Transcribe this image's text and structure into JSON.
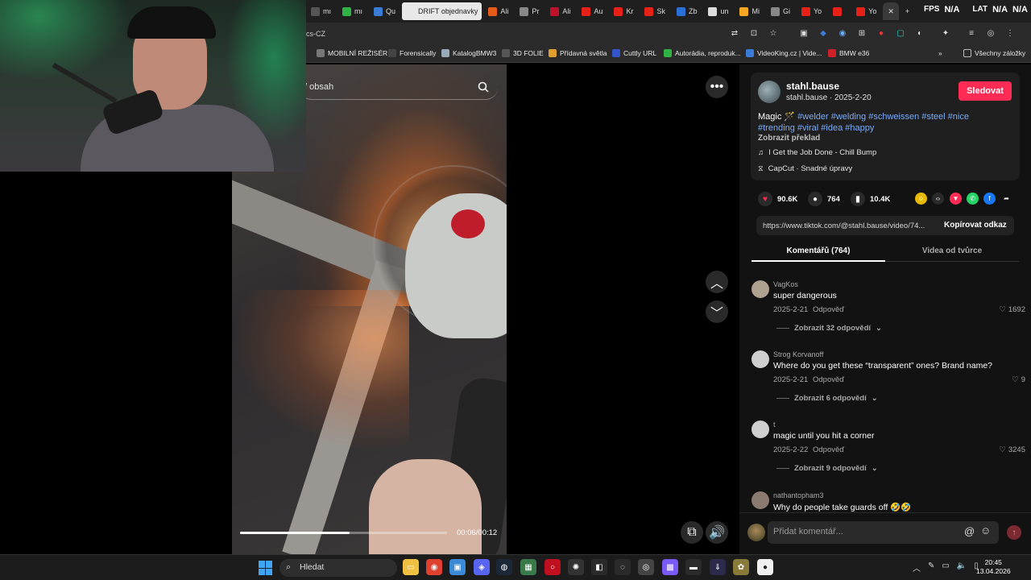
{
  "browser": {
    "tabs": [
      {
        "label": "mı",
        "color": "#555555"
      },
      {
        "label": "mı",
        "color": "#2fb344"
      },
      {
        "label": "Qu",
        "color": "#3a7bd5"
      },
      {
        "label": "DRIFT objednavky",
        "color": "#e8e8e8",
        "active": true
      },
      {
        "label": "Ali",
        "color": "#e55b1a"
      },
      {
        "label": "Pr",
        "color": "#888888"
      },
      {
        "label": "Ali",
        "color": "#c0112b"
      },
      {
        "label": "Au",
        "color": "#e62117"
      },
      {
        "label": "Kr",
        "color": "#e62117"
      },
      {
        "label": "Sk",
        "color": "#e62117"
      },
      {
        "label": "Zb",
        "color": "#2a6fd6"
      },
      {
        "label": "un",
        "color": "#dddddd"
      },
      {
        "label": "Mi",
        "color": "#f5a623"
      },
      {
        "label": "Gi",
        "color": "#888888"
      },
      {
        "label": "Yo",
        "color": "#e62117"
      },
      {
        "label": "",
        "color": "#e62117"
      },
      {
        "label": "Yo",
        "color": "#e62117"
      }
    ],
    "fps_label": "FPS",
    "fps_value": "N/A",
    "lat_label": "LAT",
    "lat_value": "N/A",
    "extra_value": "N/A",
    "url": "cs-CZ",
    "bookmarks": [
      {
        "label": "MOBILNÍ REŽISÉR",
        "color": "#777777"
      },
      {
        "label": "Forensically",
        "color": "#444444"
      },
      {
        "label": "KatalogBMW3",
        "color": "#9ab"
      },
      {
        "label": "3D FOLIE",
        "color": "#555555"
      },
      {
        "label": "Přídavná světla",
        "color": "#e0a030"
      },
      {
        "label": "Cuttly URL",
        "color": "#3355cc"
      },
      {
        "label": "Autorádia, reproduk...",
        "color": "#2fb344"
      },
      {
        "label": "VideoKing.cz | Vide...",
        "color": "#3a7bd5"
      },
      {
        "label": "BMW e36",
        "color": "#d0202a"
      }
    ],
    "all_bookmarks": "Všechny záložky"
  },
  "video": {
    "search_placeholder": "/ obsah",
    "time": "00:06/00:12",
    "progress": 0.53
  },
  "post": {
    "author": "stahl.bause",
    "author_sub": "stahl.bause · 2025-2-20",
    "follow": "Sledovat",
    "caption_start": "Magic ",
    "caption_emoji": "🪄",
    "hashtags_line1": "#welder #welding #schweissen #steel #nice",
    "hashtags_line2": "#trending #viral #idea #happy",
    "translate": "Zobrazit překlad",
    "music": "I Get the Job Done - Chill Bump",
    "capcut": "CapCut · Snadné úpravy",
    "likes": "90.6K",
    "comments_count": "764",
    "saves": "10.4K",
    "link": "https://www.tiktok.com/@stahl.bause/video/74...",
    "copy_link": "Kopírovat odkaz",
    "tab_comments": "Komentářů (764)",
    "tab_videos": "Videa od tvůrce"
  },
  "comments": [
    {
      "user": "VagKos",
      "text": "super dangerous",
      "date": "2025-2-21",
      "reply": "Odpověď",
      "likes": "1692",
      "more": "Zobrazit 32 odpovědí",
      "avatar": "#b0a090"
    },
    {
      "user": "Strog Korvanoff",
      "text": "Where do you get these “transparent” ones? Brand name?",
      "date": "2025-2-21",
      "reply": "Odpověď",
      "likes": "9",
      "more": "Zobrazit 6 odpovědí",
      "avatar": "#cfcfcf"
    },
    {
      "user": "t",
      "text": "magic until you hit a corner",
      "date": "2025-2-22",
      "reply": "Odpověď",
      "likes": "3245",
      "more": "Zobrazit 9 odpovědí",
      "avatar": "#cfcfcf"
    },
    {
      "user": "nathantopham3",
      "text": "Why do people take guards off 🤣🤣",
      "date": "",
      "reply": "",
      "likes": "",
      "more": "",
      "avatar": "#8a7a70"
    }
  ],
  "comment_box": {
    "placeholder": "Přidat komentář..."
  },
  "taskbar": {
    "search": "Hledat",
    "time": "20:45",
    "date": "13.04.2026"
  }
}
